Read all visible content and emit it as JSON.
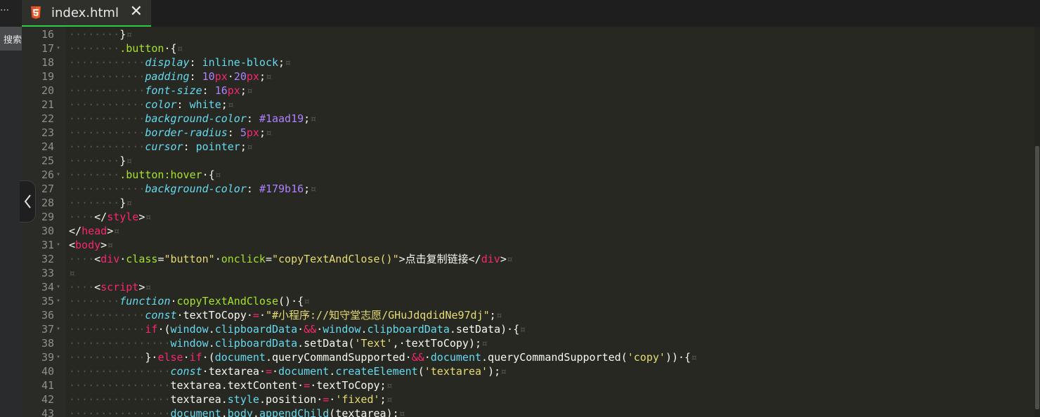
{
  "sidebar": {
    "menu_glyph": "…",
    "search_label": "搜索"
  },
  "tab": {
    "title": "index.html",
    "icon": "html5-icon",
    "close": "✕"
  },
  "colors": {
    "tab_active_border": "#2ecc40",
    "editor_bg": "#272822"
  },
  "code_lines": [
    {
      "n": 16,
      "fold": false,
      "indent": 8,
      "tokens": [
        [
          "}",
          "txt"
        ]
      ]
    },
    {
      "n": 17,
      "fold": true,
      "indent": 8,
      "tokens": [
        [
          ".button",
          "sel"
        ],
        [
          " ",
          "ws"
        ],
        [
          "{",
          "txt"
        ]
      ]
    },
    {
      "n": 18,
      "fold": false,
      "indent": 12,
      "tokens": [
        [
          "display",
          "prop"
        ],
        [
          ": ",
          "txt"
        ],
        [
          "inline-block",
          "val"
        ],
        [
          ";",
          "txt"
        ]
      ]
    },
    {
      "n": 19,
      "fold": false,
      "indent": 12,
      "tokens": [
        [
          "padding",
          "prop"
        ],
        [
          ": ",
          "txt"
        ],
        [
          "10",
          "num"
        ],
        [
          "px",
          "unit"
        ],
        [
          " ",
          "ws"
        ],
        [
          "20",
          "num"
        ],
        [
          "px",
          "unit"
        ],
        [
          ";",
          "txt"
        ]
      ]
    },
    {
      "n": 20,
      "fold": false,
      "indent": 12,
      "tokens": [
        [
          "font-size",
          "prop"
        ],
        [
          ": ",
          "txt"
        ],
        [
          "16",
          "num"
        ],
        [
          "px",
          "unit"
        ],
        [
          ";",
          "txt"
        ]
      ]
    },
    {
      "n": 21,
      "fold": false,
      "indent": 12,
      "tokens": [
        [
          "color",
          "prop"
        ],
        [
          ": ",
          "txt"
        ],
        [
          "white",
          "val"
        ],
        [
          ";",
          "txt"
        ]
      ]
    },
    {
      "n": 22,
      "fold": false,
      "indent": 12,
      "tokens": [
        [
          "background-color",
          "prop"
        ],
        [
          ": ",
          "txt"
        ],
        [
          "#1aad19",
          "num"
        ],
        [
          ";",
          "txt"
        ]
      ]
    },
    {
      "n": 23,
      "fold": false,
      "indent": 12,
      "tokens": [
        [
          "border-radius",
          "prop"
        ],
        [
          ": ",
          "txt"
        ],
        [
          "5",
          "num"
        ],
        [
          "px",
          "unit"
        ],
        [
          ";",
          "txt"
        ]
      ]
    },
    {
      "n": 24,
      "fold": false,
      "indent": 12,
      "tokens": [
        [
          "cursor",
          "prop"
        ],
        [
          ": ",
          "txt"
        ],
        [
          "pointer",
          "val"
        ],
        [
          ";",
          "txt"
        ]
      ]
    },
    {
      "n": 25,
      "fold": false,
      "indent": 8,
      "tokens": [
        [
          "}",
          "txt"
        ]
      ]
    },
    {
      "n": 26,
      "fold": true,
      "indent": 8,
      "tokens": [
        [
          ".button:hover",
          "sel"
        ],
        [
          " ",
          "ws"
        ],
        [
          "{",
          "txt"
        ]
      ]
    },
    {
      "n": 27,
      "fold": false,
      "indent": 12,
      "tokens": [
        [
          "background-color",
          "prop"
        ],
        [
          ": ",
          "txt"
        ],
        [
          "#179b16",
          "num"
        ],
        [
          ";",
          "txt"
        ]
      ]
    },
    {
      "n": 28,
      "fold": false,
      "indent": 8,
      "tokens": [
        [
          "}",
          "txt"
        ]
      ]
    },
    {
      "n": 29,
      "fold": false,
      "indent": 4,
      "tokens": [
        [
          "</",
          "txt"
        ],
        [
          "style",
          "tag"
        ],
        [
          ">",
          "txt"
        ]
      ]
    },
    {
      "n": 30,
      "fold": false,
      "indent": 0,
      "tokens": [
        [
          "</",
          "txt"
        ],
        [
          "head",
          "tag"
        ],
        [
          ">",
          "txt"
        ]
      ]
    },
    {
      "n": 31,
      "fold": true,
      "indent": 0,
      "tokens": [
        [
          "<",
          "txt"
        ],
        [
          "body",
          "tag"
        ],
        [
          ">",
          "txt"
        ]
      ]
    },
    {
      "n": 32,
      "fold": false,
      "indent": 4,
      "tokens": [
        [
          "<",
          "txt"
        ],
        [
          "div",
          "tag"
        ],
        [
          " ",
          "ws"
        ],
        [
          "class",
          "attr"
        ],
        [
          "=",
          "txt"
        ],
        [
          "\"button\"",
          "str"
        ],
        [
          " ",
          "ws"
        ],
        [
          "onclick",
          "attr"
        ],
        [
          "=",
          "txt"
        ],
        [
          "\"copyTextAndClose()\"",
          "str"
        ],
        [
          ">点击复制链接</",
          "txt"
        ],
        [
          "div",
          "tag"
        ],
        [
          ">",
          "txt"
        ]
      ]
    },
    {
      "n": 33,
      "fold": false,
      "indent": 0,
      "tokens": []
    },
    {
      "n": 34,
      "fold": true,
      "indent": 4,
      "tokens": [
        [
          "<",
          "txt"
        ],
        [
          "script",
          "tag"
        ],
        [
          ">",
          "txt"
        ]
      ]
    },
    {
      "n": 35,
      "fold": true,
      "indent": 8,
      "tokens": [
        [
          "function",
          "fkw"
        ],
        [
          " ",
          "ws"
        ],
        [
          "copyTextAndClose",
          "fn"
        ],
        [
          "()",
          "txt"
        ],
        [
          " ",
          "ws"
        ],
        [
          "{",
          "txt"
        ]
      ]
    },
    {
      "n": 36,
      "fold": false,
      "indent": 12,
      "tokens": [
        [
          "const",
          "fkw"
        ],
        [
          " ",
          "ws"
        ],
        [
          "textToCopy",
          "txt"
        ],
        [
          " ",
          "ws"
        ],
        [
          "=",
          "kw"
        ],
        [
          " ",
          "ws"
        ],
        [
          "\"#小程序://知守堂志愿/GHuJdqdidNe97dj\"",
          "str"
        ],
        [
          ";",
          "txt"
        ]
      ]
    },
    {
      "n": 37,
      "fold": true,
      "indent": 12,
      "tokens": [
        [
          "if",
          "kw"
        ],
        [
          " ",
          "ws"
        ],
        [
          "(",
          "txt"
        ],
        [
          "window",
          "obj"
        ],
        [
          ".",
          "txt"
        ],
        [
          "clipboardData",
          "obj"
        ],
        [
          " ",
          "ws"
        ],
        [
          "&&",
          "kw"
        ],
        [
          " ",
          "ws"
        ],
        [
          "window",
          "obj"
        ],
        [
          ".",
          "txt"
        ],
        [
          "clipboardData",
          "obj"
        ],
        [
          ".setData)",
          "txt"
        ],
        [
          " ",
          "ws"
        ],
        [
          "{",
          "txt"
        ]
      ]
    },
    {
      "n": 38,
      "fold": false,
      "indent": 16,
      "tokens": [
        [
          "window",
          "obj"
        ],
        [
          ".",
          "txt"
        ],
        [
          "clipboardData",
          "obj"
        ],
        [
          ".setData(",
          "txt"
        ],
        [
          "'Text'",
          "str"
        ],
        [
          ",",
          "txt"
        ],
        [
          " ",
          "ws"
        ],
        [
          "textToCopy);",
          "txt"
        ]
      ]
    },
    {
      "n": 39,
      "fold": true,
      "indent": 12,
      "tokens": [
        [
          "}",
          "txt"
        ],
        [
          " ",
          "ws"
        ],
        [
          "else",
          "kw"
        ],
        [
          " ",
          "ws"
        ],
        [
          "if",
          "kw"
        ],
        [
          " ",
          "ws"
        ],
        [
          "(",
          "txt"
        ],
        [
          "document",
          "obj"
        ],
        [
          ".queryCommandSupported",
          "txt"
        ],
        [
          " ",
          "ws"
        ],
        [
          "&&",
          "kw"
        ],
        [
          " ",
          "ws"
        ],
        [
          "document",
          "obj"
        ],
        [
          ".queryCommandSupported(",
          "txt"
        ],
        [
          "'copy'",
          "str"
        ],
        [
          "))",
          "txt"
        ],
        [
          " ",
          "ws"
        ],
        [
          "{",
          "txt"
        ]
      ]
    },
    {
      "n": 40,
      "fold": false,
      "indent": 16,
      "tokens": [
        [
          "const",
          "fkw"
        ],
        [
          " ",
          "ws"
        ],
        [
          "textarea",
          "txt"
        ],
        [
          " ",
          "ws"
        ],
        [
          "=",
          "kw"
        ],
        [
          " ",
          "ws"
        ],
        [
          "document",
          "obj"
        ],
        [
          ".",
          "txt"
        ],
        [
          "createElement",
          "obj"
        ],
        [
          "(",
          "txt"
        ],
        [
          "'textarea'",
          "str"
        ],
        [
          ");",
          "txt"
        ]
      ]
    },
    {
      "n": 41,
      "fold": false,
      "indent": 16,
      "tokens": [
        [
          "textarea",
          "txt"
        ],
        [
          ".textContent",
          "txt"
        ],
        [
          " ",
          "ws"
        ],
        [
          "=",
          "kw"
        ],
        [
          " ",
          "ws"
        ],
        [
          "textToCopy;",
          "txt"
        ]
      ]
    },
    {
      "n": 42,
      "fold": false,
      "indent": 16,
      "tokens": [
        [
          "textarea",
          "txt"
        ],
        [
          ".",
          "txt"
        ],
        [
          "style",
          "obj"
        ],
        [
          ".position",
          "txt"
        ],
        [
          " ",
          "ws"
        ],
        [
          "=",
          "kw"
        ],
        [
          " ",
          "ws"
        ],
        [
          "'fixed'",
          "str"
        ],
        [
          ";",
          "txt"
        ]
      ]
    },
    {
      "n": 43,
      "fold": false,
      "indent": 16,
      "tokens": [
        [
          "document",
          "obj"
        ],
        [
          ".",
          "txt"
        ],
        [
          "body",
          "obj"
        ],
        [
          ".",
          "txt"
        ],
        [
          "appendChild",
          "obj"
        ],
        [
          "(textarea);",
          "txt"
        ]
      ]
    }
  ]
}
